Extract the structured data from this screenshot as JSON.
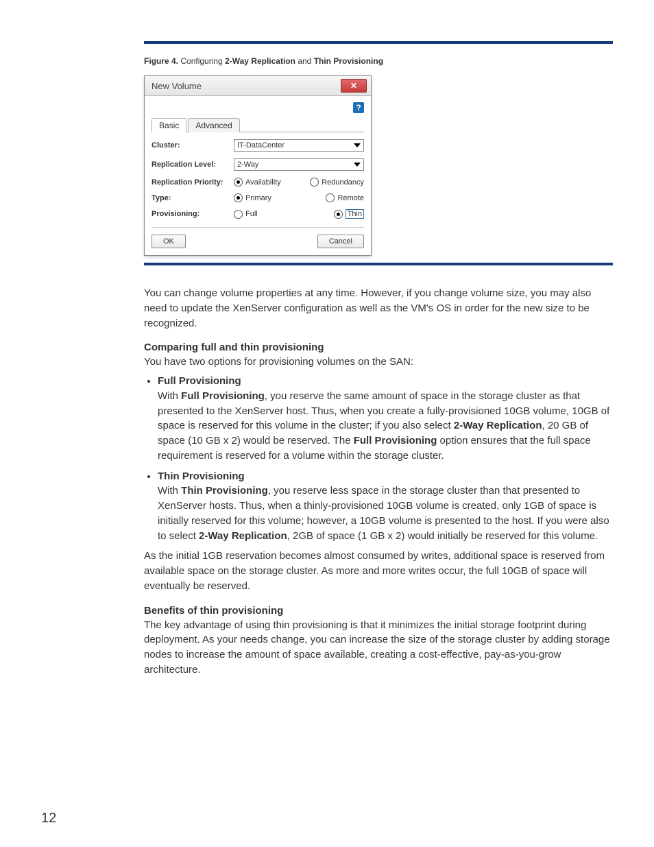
{
  "caption": {
    "prefix": "Figure 4.",
    "mid1": " Configuring ",
    "bold1": "2-Way Replication",
    "mid2": " and ",
    "bold2": "Thin Provisioning"
  },
  "dialog": {
    "title": "New Volume",
    "help_glyph": "?",
    "close_glyph": "✕",
    "tabs": {
      "basic": "Basic",
      "advanced": "Advanced"
    },
    "cluster_label": "Cluster:",
    "cluster_value": "IT-DataCenter",
    "repl_level_label": "Replication Level:",
    "repl_level_value": "2-Way",
    "repl_priority_label": "Replication Priority:",
    "repl_priority_opts": {
      "availability": "Availability",
      "redundancy": "Redundancy"
    },
    "type_label": "Type:",
    "type_opts": {
      "primary": "Primary",
      "remote": "Remote"
    },
    "prov_label": "Provisioning:",
    "prov_opts": {
      "full": "Full",
      "thin": "Thin"
    },
    "ok": "OK",
    "cancel": "Cancel"
  },
  "body": {
    "p1": "You can change volume properties at any time. However, if you change volume size, you may also need to update the XenServer configuration as well as the VM's OS in order for the new size to be recognized.",
    "h1": "Comparing full and thin provisioning",
    "p2": "You have two options for provisioning volumes on the SAN:",
    "li1_title": "Full Provisioning",
    "li1_pre": "With ",
    "li1_b1": "Full Provisioning",
    "li1_mid1": ", you reserve the same amount of space in the storage cluster as that presented to the XenServer host. Thus, when you create a fully-provisioned 10GB volume, 10GB of space is reserved for this volume in the cluster; if you also select ",
    "li1_b2": "2-Way Replication",
    "li1_mid2": ", 20 GB of space (10 GB x 2) would be reserved. The ",
    "li1_b3": "Full Provisioning",
    "li1_tail": " option ensures that the full space requirement is reserved for a volume within the storage cluster.",
    "li2_title": "Thin Provisioning",
    "li2_pre": "With ",
    "li2_b1": "Thin Provisioning",
    "li2_mid1": ", you reserve less space in the storage cluster than that presented to XenServer hosts. Thus, when a thinly-provisioned 10GB volume is created, only 1GB of space is initially reserved for this volume; however, a 10GB volume is presented to the host. If you were also to select ",
    "li2_b2": "2-Way Replication",
    "li2_tail": ", 2GB of space (1 GB x 2) would initially be reserved for this volume.",
    "p3": "As the initial 1GB reservation becomes almost consumed by writes, additional space is reserved from available space on the storage cluster. As more and more writes occur, the full 10GB of space will eventually be reserved.",
    "h2": "Benefits of thin provisioning",
    "p4": "The key advantage of using thin provisioning is that it minimizes the initial storage footprint during deployment. As your needs change, you can increase the size of the storage cluster by adding storage nodes to increase the amount of space available, creating a cost-effective, pay-as-you-grow architecture."
  },
  "page_number": "12"
}
